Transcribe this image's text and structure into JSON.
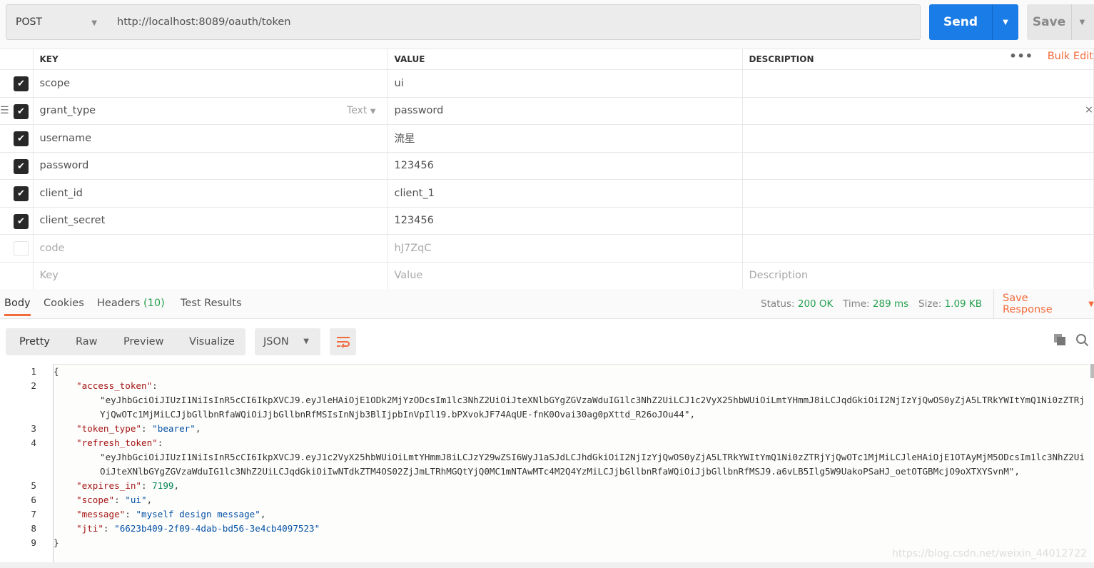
{
  "request": {
    "method": "POST",
    "url": "http://localhost:8089/oauth/token",
    "send_label": "Send",
    "save_label": "Save"
  },
  "params": {
    "headers": {
      "key": "KEY",
      "value": "VALUE",
      "description": "DESCRIPTION",
      "bulk_edit": "Bulk Edit"
    },
    "rows": [
      {
        "key": "scope",
        "value": "ui",
        "checked": true
      },
      {
        "key": "grant_type",
        "value": "password",
        "checked": true,
        "type": "Text"
      },
      {
        "key": "username",
        "value": "流星",
        "checked": true
      },
      {
        "key": "password",
        "value": "123456",
        "checked": true
      },
      {
        "key": "client_id",
        "value": "client_1",
        "checked": true
      },
      {
        "key": "client_secret",
        "value": "123456",
        "checked": true
      },
      {
        "key": "code",
        "value": "hJ7ZqC",
        "checked": false
      }
    ],
    "placeholders": {
      "key": "Key",
      "value": "Value",
      "description": "Description"
    }
  },
  "response": {
    "tabs": {
      "body": "Body",
      "cookies": "Cookies",
      "headers": "Headers",
      "headers_count": "(10)",
      "tests": "Test Results"
    },
    "status_label": "Status:",
    "status": "200 OK",
    "time_label": "Time:",
    "time": "289 ms",
    "size_label": "Size:",
    "size": "1.09 KB",
    "save_response": "Save Response",
    "views": {
      "pretty": "Pretty",
      "raw": "Raw",
      "preview": "Preview",
      "visualize": "Visualize"
    },
    "format": "JSON",
    "json": {
      "access_token": "eyJhbGciOiJIUzI1NiIsInR5cCI6IkpXVCJ9.eyJleHAiOjE1ODk2MjYzODcsIm1lc3NhZ2UiOiJteXNlbGYgZGVzaWduIG1lc3NhZ2UiLCJ1c2VyX25hbWUiOiLmtYHmmJ8iLCJqdGkiOiI2NjIzYjQwOS0yZjA5LTRkYWItYmQ1Ni0zZTRjYjQwOTc1MjMiLCJjbGllbnRfaWQiOiJjbGllbnRfMSIsInNjb3BlIjpbInVpIl19.bPXvokJF74AqUE-fnK0Ovai30ag0pXttd_R26oJOu44",
      "token_type": "bearer",
      "refresh_token": "eyJhbGciOiJIUzI1NiIsInR5cCI6IkpXVCJ9.eyJ1c2VyX25hbWUiOiLmtYHmmJ8iLCJzY29wZSI6WyJ1aSJdLCJhdGkiOiI2NjIzYjQwOS0yZjA5LTRkYWItYmQ1Ni0zZTRjYjQwOTc1MjMiLCJleHAiOjE1OTAyMjM5ODcsIm1lc3NhZ2UiOiJteXNlbGYgZGVzaWduIG1lc3NhZ2UiLCJqdGkiOiIwNTdkZTM4OS02ZjJmLTRhMGQtYjQ0MC1mNTAwMTc4M2Q4YzMiLCJjbGllbnRfaWQiOiJjbGllbnRfMSJ9.a6vLB5Ilg5W9UakoPSaHJ_oetOTGBMcjO9oXTXYSvnM",
      "expires_in": "7199",
      "scope": "ui",
      "message": "myself design message",
      "jti": "6623b409-2f09-4dab-bd56-3e4cb4097523"
    }
  },
  "watermark": "https://blog.csdn.net/weixin_44012722",
  "colors": {
    "accent": "#f26b3a",
    "send": "#1a7ce6",
    "success": "#26a150"
  }
}
